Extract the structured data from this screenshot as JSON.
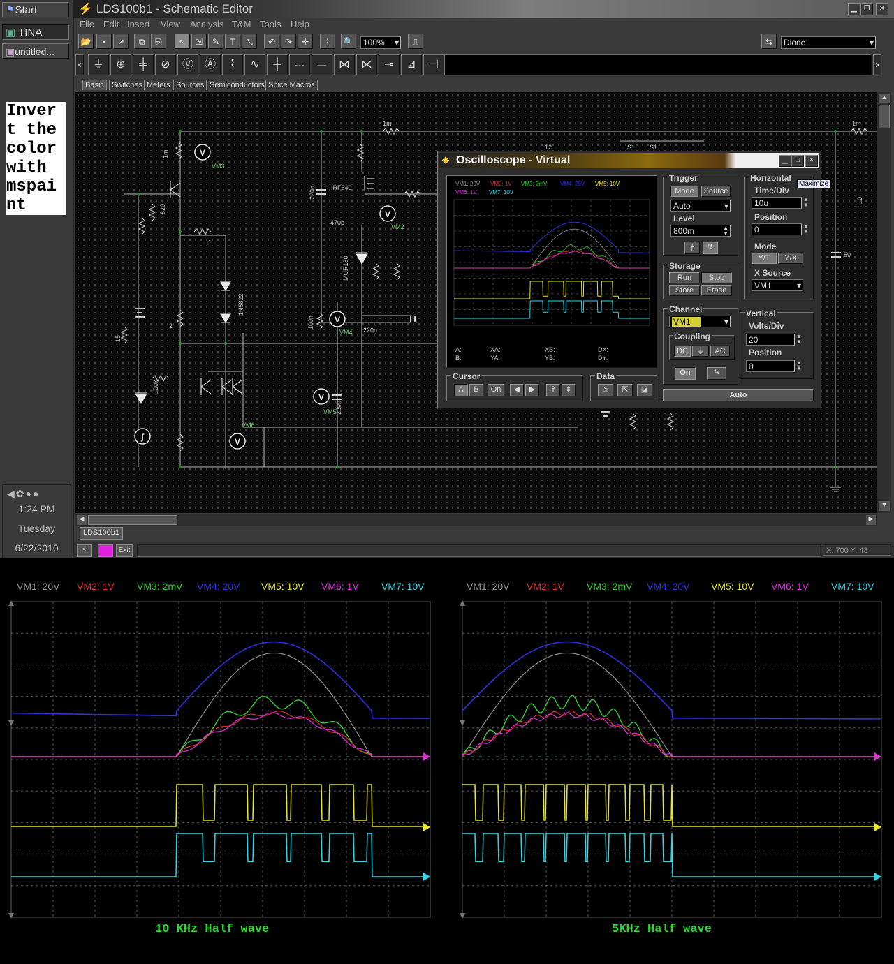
{
  "taskbar": {
    "start_label": "Start",
    "task_tina": "TINA",
    "task_untitled": "untitled...",
    "time": "1:24 PM",
    "day": "Tuesday",
    "date": "6/22/2010"
  },
  "note": {
    "text": "Invert the color with mspaint"
  },
  "window": {
    "title": "LDS100b1 - Schematic Editor",
    "menus": [
      "File",
      "Edit",
      "Insert",
      "View",
      "Analysis",
      "T&M",
      "Tools",
      "Help"
    ],
    "zoom": "100%",
    "component": "Diode",
    "tabs": [
      "Basic",
      "Switches",
      "Meters",
      "Sources",
      "Semiconductors",
      "Spice Macros"
    ],
    "doc_tab": "LDS100b1",
    "status_exit": "Exit",
    "coords": "X: 700  Y: 48"
  },
  "schematic": {
    "labels": [
      "1m",
      "1m",
      "1m",
      "12",
      "S1",
      "S1",
      "1k",
      "VM3",
      "VM2",
      "VM4",
      "VM5",
      "VM6",
      "VM7",
      "VM1",
      "820",
      "1",
      "2",
      "15",
      "100k",
      "1N5822",
      "IRF540",
      "MUR160",
      "1k",
      "25",
      "100u",
      "470p",
      "220n",
      "220n",
      "100n",
      "220n",
      "10",
      "5",
      "53",
      "50",
      "22",
      "22",
      "47k",
      "1",
      "10k",
      "1"
    ]
  },
  "osc": {
    "title": "Oscilloscope - Virtual",
    "legend": [
      "VM1: 20V",
      "VM2: 1V",
      "VM3: 2mV",
      "VM4: 20V",
      "VM5: 10V",
      "VM6: 1V",
      "VM7: 10V"
    ],
    "readouts": {
      "a": "A:",
      "b": "B:",
      "xa": "XA:",
      "ya": "YA:",
      "xb": "XB:",
      "yb": "YB:",
      "dx": "DX:",
      "dy": "DY:"
    },
    "trigger": {
      "label": "Trigger",
      "mode": "Mode",
      "source": "Source",
      "mode_value": "Auto",
      "level_label": "Level",
      "level_value": "800m"
    },
    "horizontal": {
      "label": "Horizontal",
      "timediv_label": "Time/Div",
      "timediv_value": "10u",
      "position_label": "Position",
      "position_value": "0",
      "mode_label": "Mode",
      "yt": "Y/T",
      "yx": "Y/X",
      "xsource_label": "X Source",
      "xsource_value": "VM1",
      "tooltip": "Maximize"
    },
    "storage": {
      "label": "Storage",
      "run": "Run",
      "stop": "Stop",
      "store": "Store",
      "erase": "Erase"
    },
    "channel": {
      "label": "Channel",
      "value": "VM1",
      "coupling_label": "Coupling",
      "dc": "DC",
      "gnd": "⏚",
      "ac": "AC",
      "on": "On"
    },
    "vertical": {
      "label": "Vertical",
      "voltsdiv_label": "Volts/Div",
      "voltsdiv_value": "20",
      "position_label": "Position",
      "position_value": "0"
    },
    "cursor": {
      "label": "Cursor",
      "a": "A",
      "b": "B",
      "on": "On"
    },
    "data": {
      "label": "Data"
    },
    "auto": "Auto"
  },
  "scopes": [
    {
      "caption": "10 KHz Half wave",
      "legend": [
        {
          "text": "VM1: 20V",
          "color": "#909090"
        },
        {
          "text": "VM2: 1V",
          "color": "#e03030"
        },
        {
          "text": "VM3: 2mV",
          "color": "#30d030"
        },
        {
          "text": "VM4: 20V",
          "color": "#3030e0"
        },
        {
          "text": "VM5: 10V",
          "color": "#e8e830"
        },
        {
          "text": "VM6: 1V",
          "color": "#e030e0"
        },
        {
          "text": "VM7: 10V",
          "color": "#30d8e8"
        }
      ]
    },
    {
      "caption": "5KHz Half wave",
      "legend": [
        {
          "text": "VM1: 20V",
          "color": "#909090"
        },
        {
          "text": "VM2: 1V",
          "color": "#e03030"
        },
        {
          "text": "VM3: 2mV",
          "color": "#30d030"
        },
        {
          "text": "VM4: 20V",
          "color": "#3030e0"
        },
        {
          "text": "VM5: 10V",
          "color": "#e8e830"
        },
        {
          "text": "VM6: 1V",
          "color": "#e030e0"
        },
        {
          "text": "VM7: 10V",
          "color": "#30d8e8"
        }
      ]
    }
  ],
  "colors": {
    "vm1": "#909090",
    "vm2": "#e03030",
    "vm3": "#30d030",
    "vm4": "#3030e0",
    "vm5": "#e8e830",
    "vm6": "#e030e0",
    "vm7": "#30d8e8"
  }
}
